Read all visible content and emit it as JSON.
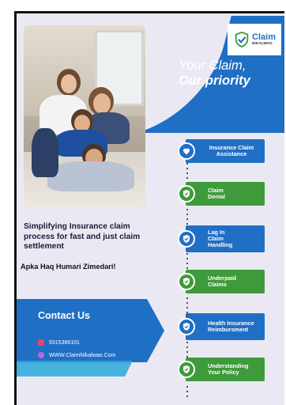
{
  "logo": {
    "main": "Claim",
    "sub": "NIKALWAO",
    "icon": "check-shield-icon"
  },
  "slogan": {
    "line1": "Your Claim,",
    "line2": "Our priority"
  },
  "headline": "Simplifying Insurance claim process for fast and just claim settlement",
  "tagline": "Apka Haq Humari Zimedari!",
  "contact": {
    "title": "Contact Us",
    "phone": "9315366101",
    "website": "WWW.ClaimNikalwao.Com"
  },
  "steps": [
    {
      "label": "Insurance Claim Assistance",
      "color": "#1f6fc5",
      "icon": "heart-shield-icon"
    },
    {
      "label": "Claim Denial",
      "color": "#3e9a3b",
      "icon": "check-shield-icon"
    },
    {
      "label": "Lag In Claim Handling",
      "color": "#1f6fc5",
      "icon": "check-shield-icon"
    },
    {
      "label": "Underpaid Claims",
      "color": "#3e9a3b",
      "icon": "check-shield-icon"
    },
    {
      "label": "Health Insurance Reimbursment",
      "color": "#1f6fc5",
      "icon": "check-shield-icon"
    },
    {
      "label": "Understanding Your Policy",
      "color": "#3e9a3b",
      "icon": "check-shield-icon"
    }
  ],
  "colors": {
    "brand_blue": "#1f6fc5",
    "brand_green": "#3e9a3b",
    "background": "#eae9f3"
  }
}
